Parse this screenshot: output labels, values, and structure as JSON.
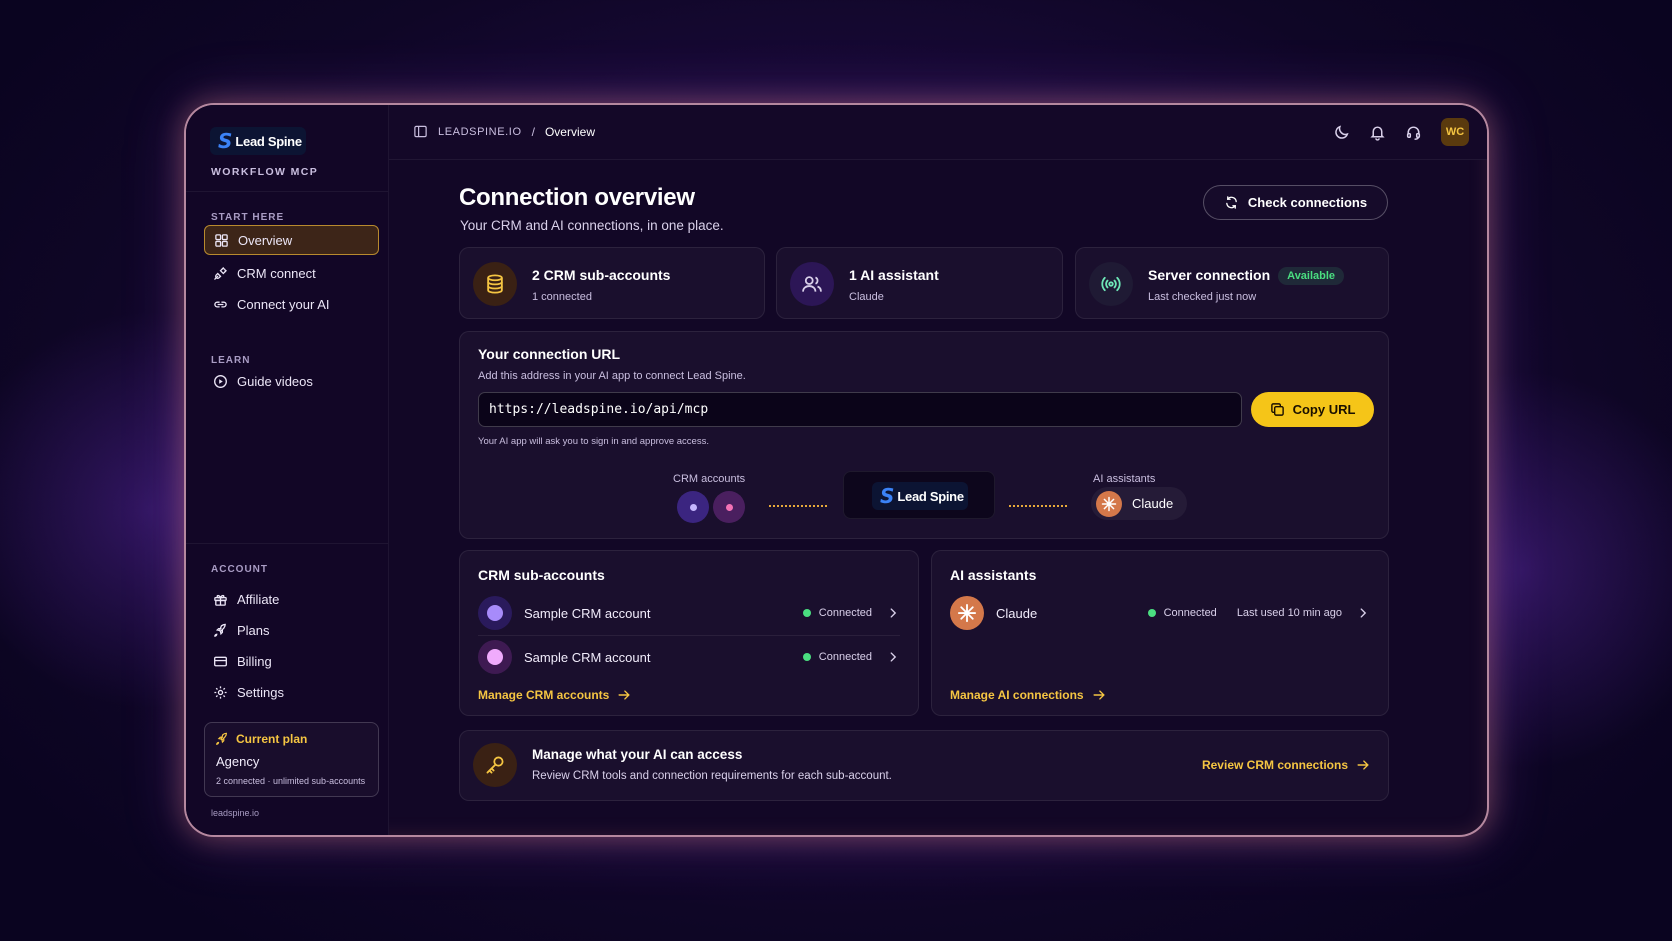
{
  "brand": {
    "logo_mark": "S",
    "logo_text": "Lead Spine",
    "product": "WORKFLOW MCP",
    "footer": "leadspine.io"
  },
  "sidebar": {
    "start_label": "START HERE",
    "start_items": [
      {
        "label": "Overview",
        "icon": "grid-icon",
        "active": true
      },
      {
        "label": "CRM connect",
        "icon": "plug-icon"
      },
      {
        "label": "Connect your AI",
        "icon": "link-icon"
      }
    ],
    "learn_label": "LEARN",
    "learn_items": [
      {
        "label": "Guide videos",
        "icon": "play-circle-icon"
      }
    ],
    "account_label": "ACCOUNT",
    "account_items": [
      {
        "label": "Affiliate",
        "icon": "gift-icon"
      },
      {
        "label": "Plans",
        "icon": "rocket-icon"
      },
      {
        "label": "Billing",
        "icon": "card-icon"
      },
      {
        "label": "Settings",
        "icon": "gear-icon"
      }
    ],
    "plan": {
      "title": "Current plan",
      "name": "Agency",
      "detail": "2 connected · unlimited sub-accounts"
    }
  },
  "topbar": {
    "breadcrumb_root": "LEADSPINE.IO",
    "breadcrumb_sep": "/",
    "breadcrumb_current": "Overview",
    "avatar_initials": "WC"
  },
  "header": {
    "title": "Connection overview",
    "subtitle": "Your CRM and AI connections, in one place.",
    "check_button": "Check connections"
  },
  "stats": [
    {
      "title": "2 CRM sub-accounts",
      "sub": "1 connected",
      "icon": "database-icon"
    },
    {
      "title": "1 AI assistant",
      "sub": "Claude",
      "icon": "users-icon"
    },
    {
      "title": "Server connection",
      "sub": "Last checked just now",
      "badge": "Available",
      "icon": "broadcast-icon"
    }
  ],
  "connection": {
    "title": "Your connection URL",
    "subtitle": "Add this address in your AI app to connect Lead Spine.",
    "url": "https://leadspine.io/api/mcp",
    "copy_button": "Copy URL",
    "note": "Your AI app will ask you to sign in and approve access.",
    "flow_left_label": "CRM accounts",
    "flow_right_label": "AI assistants",
    "flow_ai_name": "Claude"
  },
  "crm_panel": {
    "title": "CRM sub-accounts",
    "rows": [
      {
        "name": "Sample CRM account",
        "status": "Connected"
      },
      {
        "name": "Sample CRM account",
        "status": "Connected"
      }
    ],
    "link": "Manage CRM accounts"
  },
  "ai_panel": {
    "title": "AI assistants",
    "rows": [
      {
        "name": "Claude",
        "status": "Connected",
        "last_used": "Last used 10 min ago"
      }
    ],
    "link": "Manage AI connections"
  },
  "access": {
    "title": "Manage what your AI can access",
    "subtitle": "Review CRM tools and connection requirements for each sub-account.",
    "link": "Review CRM connections"
  },
  "colors": {
    "accent": "#f5c518",
    "success": "#4ade80",
    "brand_blue": "#3b82f6"
  }
}
